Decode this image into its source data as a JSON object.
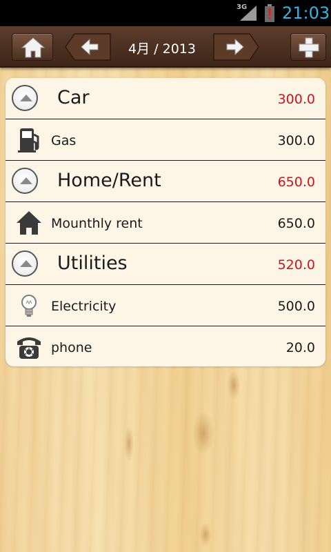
{
  "status_bar": {
    "network": "3G",
    "time": "21:03"
  },
  "toolbar": {
    "home_icon": "home-icon",
    "prev_icon": "arrow-left-icon",
    "next_icon": "arrow-right-icon",
    "add_icon": "plus-icon",
    "month_label": "4月 / 2013"
  },
  "groups": [
    {
      "name": "Car",
      "total": "300.0",
      "items": [
        {
          "icon": "fuel-pump-icon",
          "name": "Gas",
          "amount": "300.0"
        }
      ]
    },
    {
      "name": "Home/Rent",
      "total": "650.0",
      "items": [
        {
          "icon": "house-icon",
          "name": "Mounthly rent",
          "amount": "650.0"
        }
      ]
    },
    {
      "name": "Utilities",
      "total": "520.0",
      "items": [
        {
          "icon": "lightbulb-icon",
          "name": "Electricity",
          "amount": "500.0"
        },
        {
          "icon": "telephone-icon",
          "name": "phone",
          "amount": "20.0"
        }
      ]
    }
  ],
  "colors": {
    "group_total": "#d0101b",
    "status_time": "#33b5e5",
    "toolbar": "#4b2f20",
    "card": "#fdf6e6"
  }
}
